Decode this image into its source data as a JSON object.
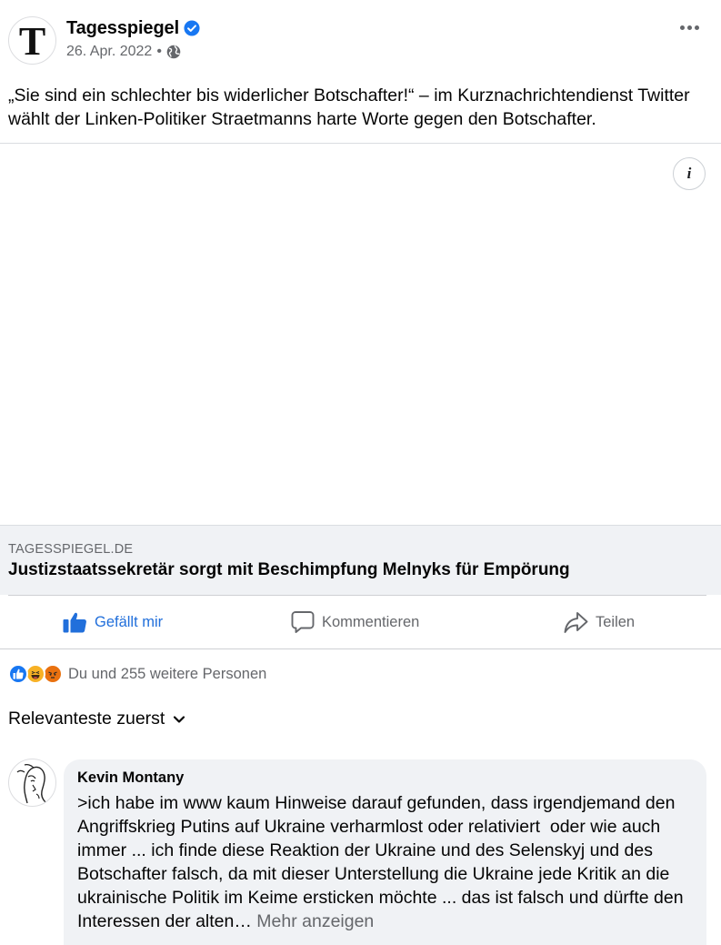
{
  "post": {
    "page_name": "Tagesspiegel",
    "avatar_letter": "T",
    "date": "26. Apr. 2022",
    "separator": "•",
    "text": "„Sie sind ein schlechter bis widerlicher Botschafter!“ – im Kurznachrichtendienst Twitter wählt der Linken-Politiker Straetmanns harte Worte gegen den Botschafter.",
    "info_icon_glyph": "i"
  },
  "link_preview": {
    "domain": "TAGESSPIEGEL.DE",
    "title": "Justizstaatssekretär sorgt mit Beschimpfung Melnyks für Empörung"
  },
  "actions": {
    "like_label": "Gefällt mir",
    "comment_label": "Kommentieren",
    "share_label": "Teilen"
  },
  "reactions": {
    "summary": "Du und 255 weitere Personen",
    "types": [
      "like",
      "haha",
      "angry"
    ]
  },
  "sort": {
    "label": "Relevanteste zuerst"
  },
  "comments": [
    {
      "author": "Kevin Montany",
      "text": ">ich habe im www kaum Hinweise darauf gefunden, dass irgendjemand den Angriffskrieg Putins auf Ukraine verharmlost oder relativiert  oder wie auch immer ... ich finde diese Reaktion der Ukraine und des Selenskyj und des Botschafter falsch, da mit dieser Unterstellung die Ukraine jede Kritik an die ukrainische Politik im Keime ersticken möchte ... das ist falsch und dürfte den Interessen der alten… ",
      "more_label": "Mehr anzeigen"
    }
  ],
  "colors": {
    "brand_blue": "#1877f2",
    "like_active": "#216fdb",
    "secondary_text": "#65676b",
    "link_box_bg": "#f0f2f5",
    "haha_yellow": "#f7b125",
    "angry_orange": "#e9710f"
  },
  "icons": {
    "verified": "verified-badge-icon",
    "audience": "globe-icon",
    "menu": "more-horizontal-icon",
    "info": "info-icon",
    "like": "thumbs-up-icon",
    "comment": "speech-bubble-icon",
    "share": "share-arrow-icon",
    "sort": "chevron-down-icon"
  }
}
